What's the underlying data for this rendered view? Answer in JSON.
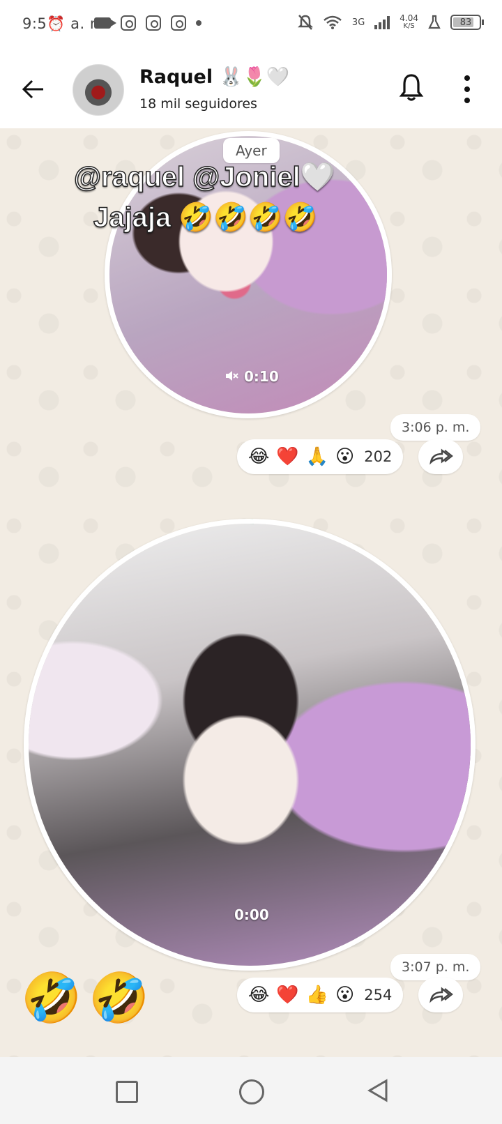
{
  "status_bar": {
    "time": "9:5⏰ a. m.",
    "network": "3G",
    "speed": "4.04",
    "speed_unit": "K/S",
    "battery": "83",
    "battery_level": 0.83
  },
  "header": {
    "name": "Raquel 🐰🌷🤍",
    "followers": "18 mil seguidores"
  },
  "chat": {
    "day_label": "Ayer",
    "messages": [
      {
        "overlay_line1": "@raquel @Joniel🤍",
        "overlay_line2": "Jajaja 🤣🤣🤣🤣",
        "duration": "0:10",
        "time": "3:06 p. m.",
        "reactions": [
          "😂",
          "❤️",
          "🙏",
          "😮"
        ],
        "reaction_count": "202"
      },
      {
        "duration": "0:00",
        "time": "3:07 p. m.",
        "reactions": [
          "😂",
          "❤️",
          "👍",
          "😮"
        ],
        "reaction_count": "254"
      }
    ],
    "emoji_text": "🤣🤣"
  },
  "colors": {
    "chat_bg": "#f2ece3",
    "accent_green": "#1aa364"
  },
  "icons": {
    "back": "back-arrow-icon",
    "bell": "bell-icon",
    "menu": "more-vert-icon",
    "forward": "forward-icon",
    "mute": "mute-icon"
  }
}
